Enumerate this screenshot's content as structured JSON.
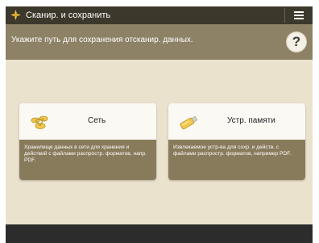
{
  "app": {
    "title": "Сканир. и сохранить",
    "icon": "scan-save-icon"
  },
  "header": {
    "menu_icon": "hamburger-icon"
  },
  "info": {
    "instruction": "Укажите путь для сохранения отсканир. данных.",
    "help_label": "?"
  },
  "options": [
    {
      "id": "network",
      "label": "Сеть",
      "icon": "network-icon",
      "description": "Хранилище данных в сети для хранения и действий с файлами распростр. форматов, напр. PDF."
    },
    {
      "id": "memory",
      "label": "Устр. памяти",
      "icon": "usb-memory-icon",
      "description": "Извлекаемое устр-ва для сохр. и действ. с файлами распростр. форматов, например PDF."
    }
  ],
  "colors": {
    "accent": "#f2c94c",
    "topbar": "#3d382c",
    "infobar": "#8d8166",
    "background": "#eae2cd",
    "description_panel": "#887b5c"
  }
}
